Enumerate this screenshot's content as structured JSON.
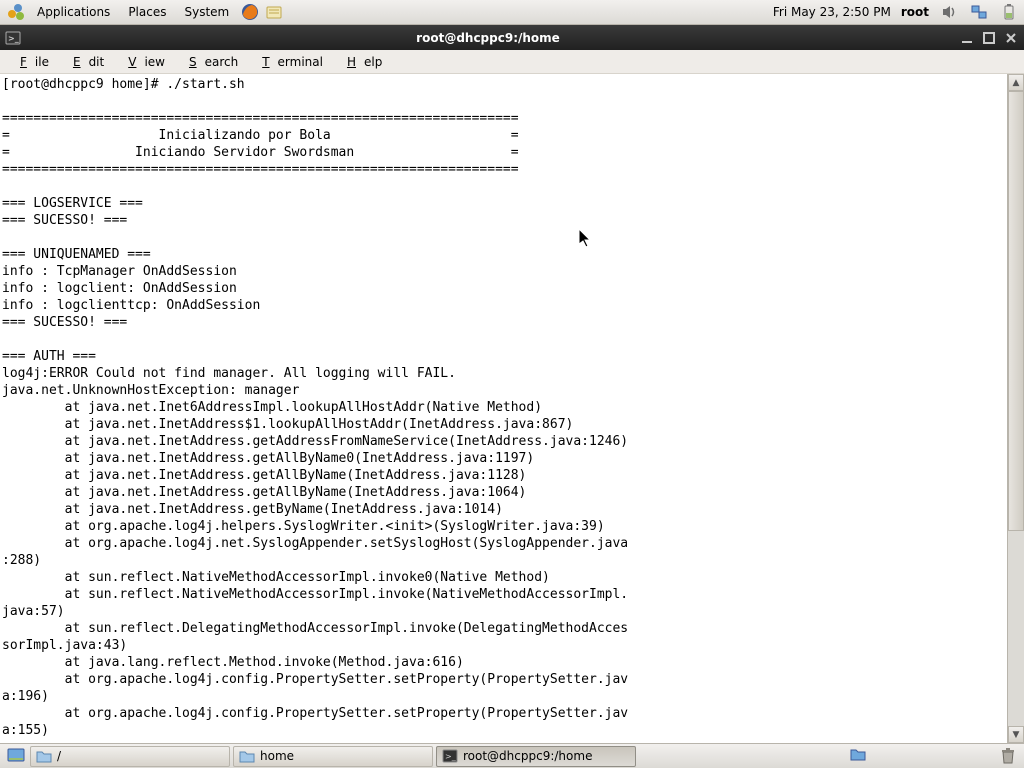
{
  "top_panel": {
    "apps": "Applications",
    "places": "Places",
    "system": "System",
    "clock": "Fri May 23,  2:50 PM",
    "user": "root"
  },
  "window": {
    "title": "root@dhcppc9:/home"
  },
  "menubar": {
    "file": "File",
    "edit": "Edit",
    "view": "View",
    "search": "Search",
    "terminal": "Terminal",
    "help": "Help"
  },
  "terminal_text": "[root@dhcppc9 home]# ./start.sh\n\n==================================================================\n=                   Inicializando por Bola                       =\n=                Iniciando Servidor Swordsman                    =\n==================================================================\n\n=== LOGSERVICE ===\n=== SUCESSO! ===\n\n=== UNIQUENAMED ===\ninfo : TcpManager OnAddSession\ninfo : logclient: OnAddSession\ninfo : logclienttcp: OnAddSession\n=== SUCESSO! ===\n\n=== AUTH ===\nlog4j:ERROR Could not find manager. All logging will FAIL.\njava.net.UnknownHostException: manager\n        at java.net.Inet6AddressImpl.lookupAllHostAddr(Native Method)\n        at java.net.InetAddress$1.lookupAllHostAddr(InetAddress.java:867)\n        at java.net.InetAddress.getAddressFromNameService(InetAddress.java:1246)\n        at java.net.InetAddress.getAllByName0(InetAddress.java:1197)\n        at java.net.InetAddress.getAllByName(InetAddress.java:1128)\n        at java.net.InetAddress.getAllByName(InetAddress.java:1064)\n        at java.net.InetAddress.getByName(InetAddress.java:1014)\n        at org.apache.log4j.helpers.SyslogWriter.<init>(SyslogWriter.java:39)\n        at org.apache.log4j.net.SyslogAppender.setSyslogHost(SyslogAppender.java\n:288)\n        at sun.reflect.NativeMethodAccessorImpl.invoke0(Native Method)\n        at sun.reflect.NativeMethodAccessorImpl.invoke(NativeMethodAccessorImpl.\njava:57)\n        at sun.reflect.DelegatingMethodAccessorImpl.invoke(DelegatingMethodAcces\nsorImpl.java:43)\n        at java.lang.reflect.Method.invoke(Method.java:616)\n        at org.apache.log4j.config.PropertySetter.setProperty(PropertySetter.jav\na:196)\n        at org.apache.log4j.config.PropertySetter.setProperty(PropertySetter.jav\na:155)",
  "taskbar": {
    "item1": "/",
    "item2": "home",
    "item3": "root@dhcppc9:/home"
  }
}
